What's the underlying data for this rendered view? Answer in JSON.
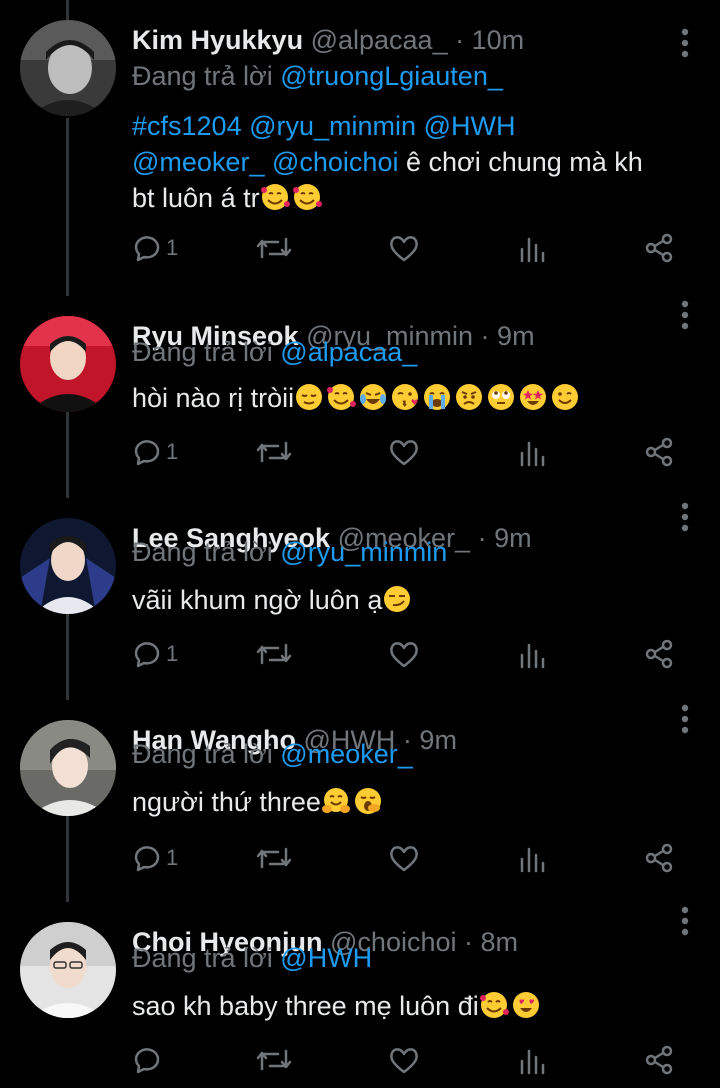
{
  "colors": {
    "background": "#000000",
    "name": "#e7e9ea",
    "muted": "#71767b",
    "link": "#1d9bf0",
    "thread_line": "#333639"
  },
  "reply_prefix": "Đang trả lời",
  "tweets": [
    {
      "name": "Kim Hyukkyu",
      "handle": "@alpacaa_",
      "separator": "·",
      "time": "10m",
      "reply_to": "@truongLgiauten_",
      "body_line1_hashtag": "#cfs1204",
      "body_line1_m1": "@ryu_minmin",
      "body_line1_m2": "@HWH",
      "body_line2_m1": "@meoker_",
      "body_line2_m2": "@choichoi",
      "body_line2_text": "ê chơi chung mà kh",
      "body_line3_text": "bt luôn á tr",
      "emojis": [
        "smiling-face-with-hearts",
        "smiling-face-with-hearts"
      ],
      "reply_count": "1",
      "avatar_icon": "avatar-kim-hyukkyu"
    },
    {
      "name": "Ryu Minseok",
      "handle": "@ryu_minmin",
      "separator": "·",
      "time": "9m",
      "reply_to": "@alpacaa_",
      "body_text": "hòi nào rị tròii",
      "emojis": [
        "relieved-face",
        "smiling-face-with-hearts",
        "face-with-tears-of-joy",
        "face-blowing-kiss",
        "loudly-crying-face",
        "angry-face",
        "face-with-rolling-eyes",
        "star-struck",
        "winking-face"
      ],
      "reply_count": "1",
      "avatar_icon": "avatar-ryu-minseok"
    },
    {
      "name": "Lee Sanghyeok",
      "handle": "@meoker_",
      "separator": "·",
      "time": "9m",
      "reply_to": "@ryu_minmin",
      "body_text": "vãii khum ngờ luôn ạ",
      "emojis": [
        "smirking-face"
      ],
      "reply_count": "1",
      "avatar_icon": "avatar-lee-sanghyeok"
    },
    {
      "name": "Han Wangho",
      "handle": "@HWH",
      "separator": "·",
      "time": "9m",
      "reply_to": "@meoker_",
      "body_text": "người thứ three",
      "emojis": [
        "hugging-face",
        "yawning-face"
      ],
      "reply_count": "1",
      "avatar_icon": "avatar-han-wangho"
    },
    {
      "name": "Choi Hyeonjun",
      "handle": "@choichoi",
      "separator": "·",
      "time": "8m",
      "reply_to": "@HWH",
      "body_text": "sao kh baby three mẹ luôn đi",
      "emojis": [
        "smiling-face-with-hearts",
        "smiling-face-with-heart-eyes"
      ],
      "reply_count": "",
      "avatar_icon": "avatar-choi-hyeonjun"
    }
  ]
}
